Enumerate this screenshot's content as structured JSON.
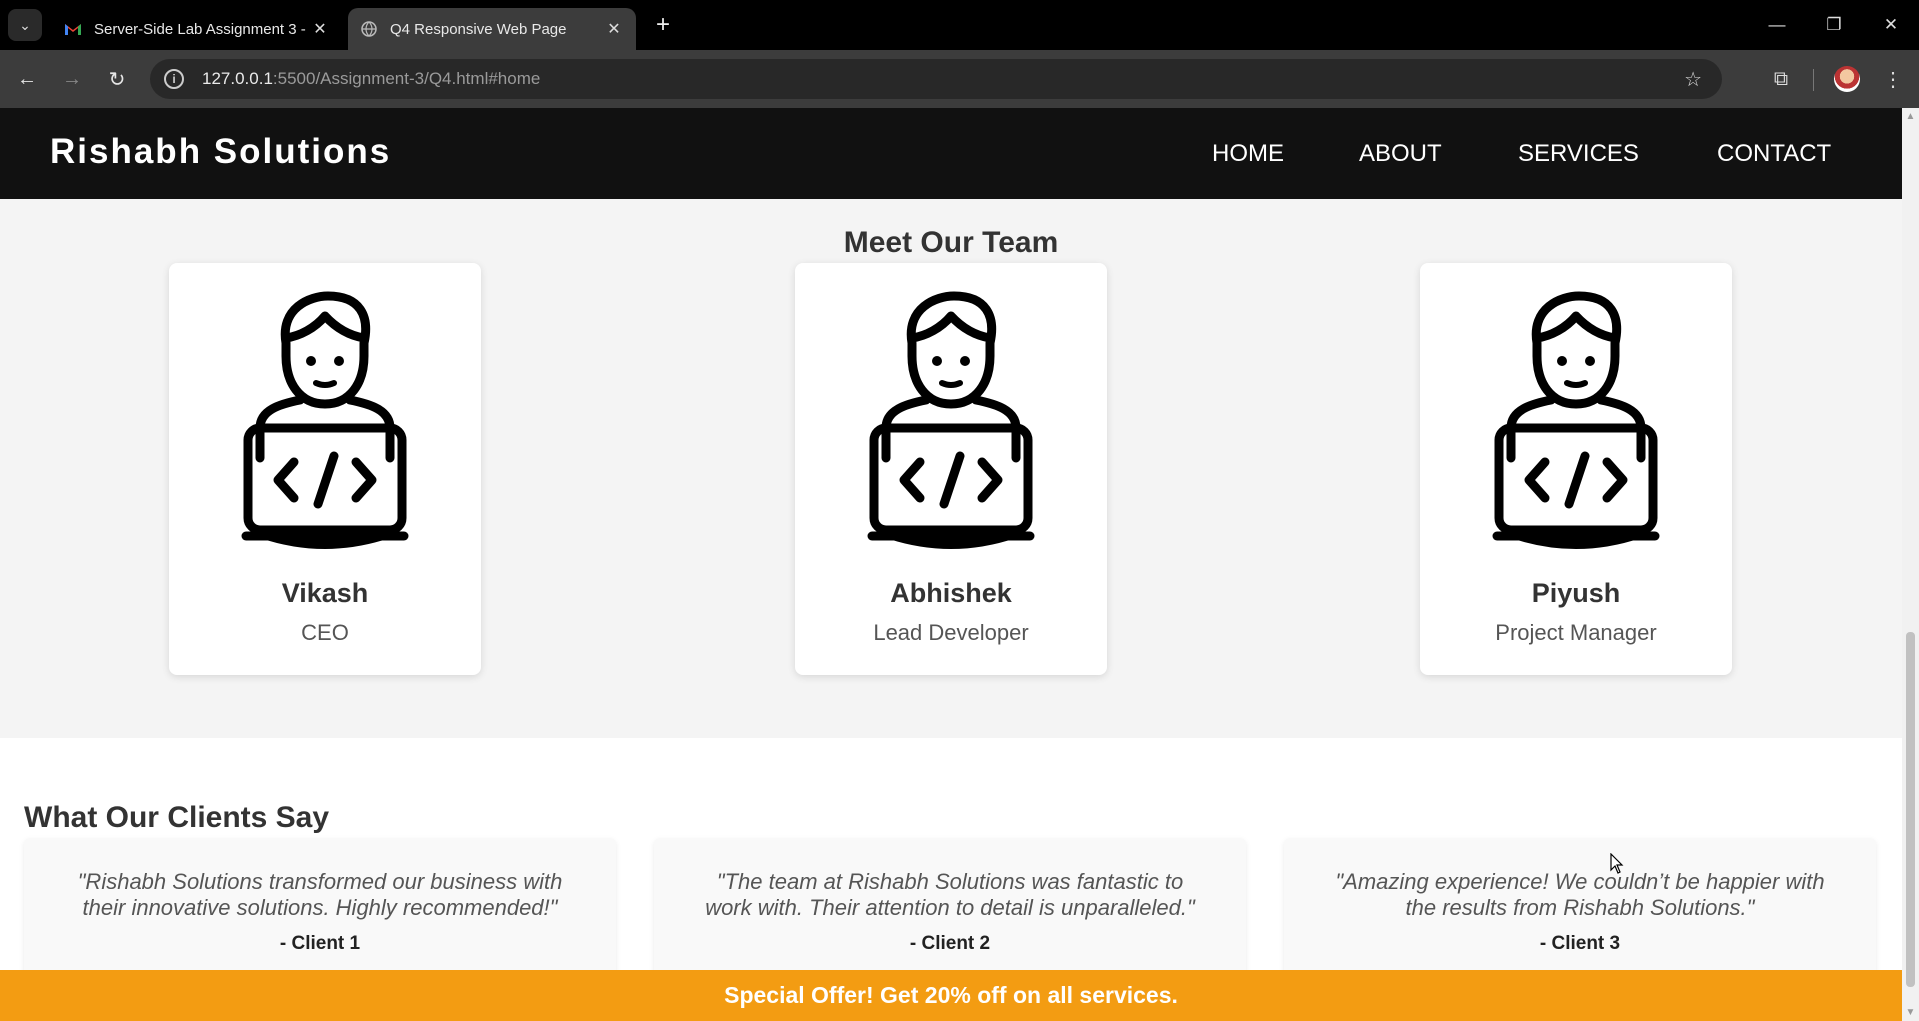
{
  "browser": {
    "tabs": [
      {
        "title": "Server-Side Lab Assignment 3 -",
        "icon": "gmail-icon",
        "active": false
      },
      {
        "title": "Q4 Responsive Web Page",
        "icon": "globe-icon",
        "active": true
      }
    ],
    "url_host": "127.0.0.1",
    "url_path": ":5500/Assignment-3/Q4.html#home"
  },
  "site": {
    "brand": "Rishabh Solutions",
    "menu": [
      "HOME",
      "ABOUT",
      "SERVICES",
      "CONTACT"
    ],
    "team_title": "Meet Our Team",
    "team": [
      {
        "name": "Vikash",
        "role": "CEO"
      },
      {
        "name": "Abhishek",
        "role": "Lead Developer"
      },
      {
        "name": "Piyush",
        "role": "Project Manager"
      }
    ],
    "clients_title": "What Our Clients Say",
    "testimonials": [
      {
        "quote": "\"Rishabh Solutions transformed our business with their innovative solutions. Highly recommended!\"",
        "client": "- Client 1"
      },
      {
        "quote": "\"The team at Rishabh Solutions was fantastic to work with. Their attention to detail is unparalleled.\"",
        "client": "- Client 2"
      },
      {
        "quote": "\"Amazing experience! We couldn’t be happier with the results from Rishabh Solutions.\"",
        "client": "- Client 3"
      }
    ],
    "offer": "Special Offer! Get 20% off on all services."
  },
  "colors": {
    "nav_bg": "#111111",
    "offer_bg": "#f39c12",
    "page_bg": "#f4f4f4"
  }
}
